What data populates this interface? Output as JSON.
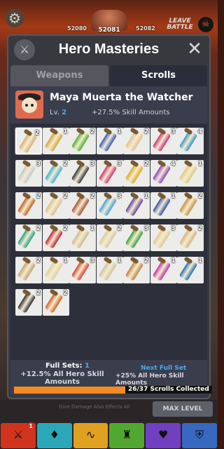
{
  "hud": {
    "left_value": "52080",
    "center_value": "52081",
    "right_value": "52082",
    "leave_label": "LEAVE BATTLE"
  },
  "panel": {
    "title": "Hero Masteries",
    "tabs": [
      {
        "label": "Weapons",
        "active": false
      },
      {
        "label": "Scrolls",
        "active": true
      }
    ]
  },
  "hero": {
    "name": "Maya Muerta the Watcher",
    "level_label": "Lv.",
    "level": "2",
    "bonus": "+27.5% Skill Amounts"
  },
  "scrolls": [
    {
      "count": "2",
      "color": "#d8b070",
      "selected": true
    },
    {
      "count": "1",
      "color": "#d8a040"
    },
    {
      "count": "2",
      "color": "#4cb030"
    },
    {
      "count": "1",
      "color": "#3058b8"
    },
    {
      "count": "2",
      "color": "#e0c090"
    },
    {
      "count": "3",
      "color": "#c83070"
    },
    {
      "count": "4",
      "color": "#3098c8"
    },
    {
      "count": "3",
      "color": "#c0c8d0"
    },
    {
      "count": "2",
      "color": "#38b0d8"
    },
    {
      "count": "3",
      "color": "#303038"
    },
    {
      "count": "3",
      "color": "#d03070"
    },
    {
      "count": "2",
      "color": "#e0a820"
    },
    {
      "count": "4",
      "color": "#8a40c0"
    },
    {
      "count": "1",
      "color": "#e0c880"
    },
    {
      "count": "2",
      "color": "#c06020"
    },
    {
      "count": "2",
      "color": "#d8c090"
    },
    {
      "count": "2",
      "color": "#a05030"
    },
    {
      "count": "3",
      "color": "#40a0e0"
    },
    {
      "count": "1",
      "color": "#6040a0"
    },
    {
      "count": "1",
      "color": "#3050a8"
    },
    {
      "count": "2",
      "color": "#c89040"
    },
    {
      "count": "2",
      "color": "#20a080"
    },
    {
      "count": "2",
      "color": "#c02030"
    },
    {
      "count": "1",
      "color": "#d0b890"
    },
    {
      "count": "2",
      "color": "#d8c8a0"
    },
    {
      "count": "3",
      "color": "#30a040"
    },
    {
      "count": "3",
      "color": "#e0c890"
    },
    {
      "count": "2",
      "color": "#d8b080"
    },
    {
      "count": "2",
      "color": "#c8a070"
    },
    {
      "count": "1",
      "color": "#e0d0a0"
    },
    {
      "count": "3",
      "color": "#d84030"
    },
    {
      "count": "1",
      "color": "#d0c0a0"
    },
    {
      "count": "2",
      "color": "#c08040"
    },
    {
      "count": "1",
      "color": "#c030a0"
    },
    {
      "count": "1",
      "color": "#2070b0"
    },
    {
      "count": "2",
      "color": "#302830"
    },
    {
      "count": "2",
      "color": "#d06020"
    }
  ],
  "footer": {
    "full_sets_label": "Full Sets:",
    "full_sets_value": "1",
    "full_sets_bonus": "+12.5% All Hero Skill Amounts",
    "next_label": "Next Full Set",
    "next_bonus": "+25% All Hero Skill Amounts",
    "collected": 26,
    "total": 37,
    "collected_text": "26/37 Scrolls Collected"
  },
  "bottom": {
    "max_level": "MAX LEVEL",
    "strip_text": "Give Damage Also Effects All",
    "notification": "1",
    "nav_colors": [
      "#d0341c",
      "#2aa8b8",
      "#e0a020",
      "#50a830",
      "#7040c0",
      "#3868c0"
    ],
    "nav_icons": [
      "sword-icon",
      "shirt-icon",
      "pulse-icon",
      "helmet-icon",
      "heart-icon",
      "shield-icon"
    ]
  }
}
